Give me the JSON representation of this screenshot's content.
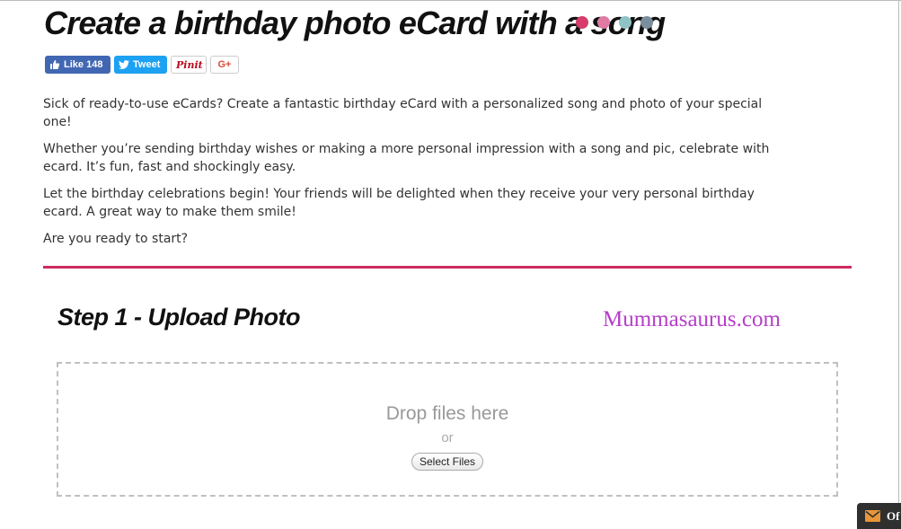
{
  "page": {
    "title": "Create a birthday photo eCard with a song"
  },
  "title_dots": {
    "colors": [
      "#d63d6c",
      "#e07aa3",
      "#8fc3c5",
      "#7a8e9e"
    ]
  },
  "social": {
    "like_label": "Like",
    "like_count": "148",
    "tweet_label": "Tweet",
    "pin_label": "Pinit",
    "gplus_label": "G+",
    "colors": {
      "facebook": "#4267b2",
      "twitter": "#1da1f2",
      "pinterest": "#bd081c",
      "gplus": "#dd4b39"
    }
  },
  "intro": {
    "p1": "Sick of ready-to-use eCards? Create a fantastic birthday eCard with a personalized song and photo of your special one!",
    "p2": "Whether you’re sending birthday wishes or making a more personal impression with a song and pic, celebrate with ecard. It’s fun, fast and shockingly easy.",
    "p3": "Let the birthday celebrations begin! Your friends will be delighted when they receive your very personal birthday ecard. A great way to make them smile!",
    "p4": "Are you ready to start?"
  },
  "divider_color": "#cc2b5e",
  "step1": {
    "title": "Step 1 - Upload Photo",
    "watermark": "Mummasaurus.com",
    "watermark_color": "#b43fc8"
  },
  "dropzone": {
    "drop_text": "Drop files here",
    "or_text": "or",
    "select_label": "Select Files"
  },
  "corner_widget": {
    "icon": "mail-icon",
    "label": "Of"
  }
}
